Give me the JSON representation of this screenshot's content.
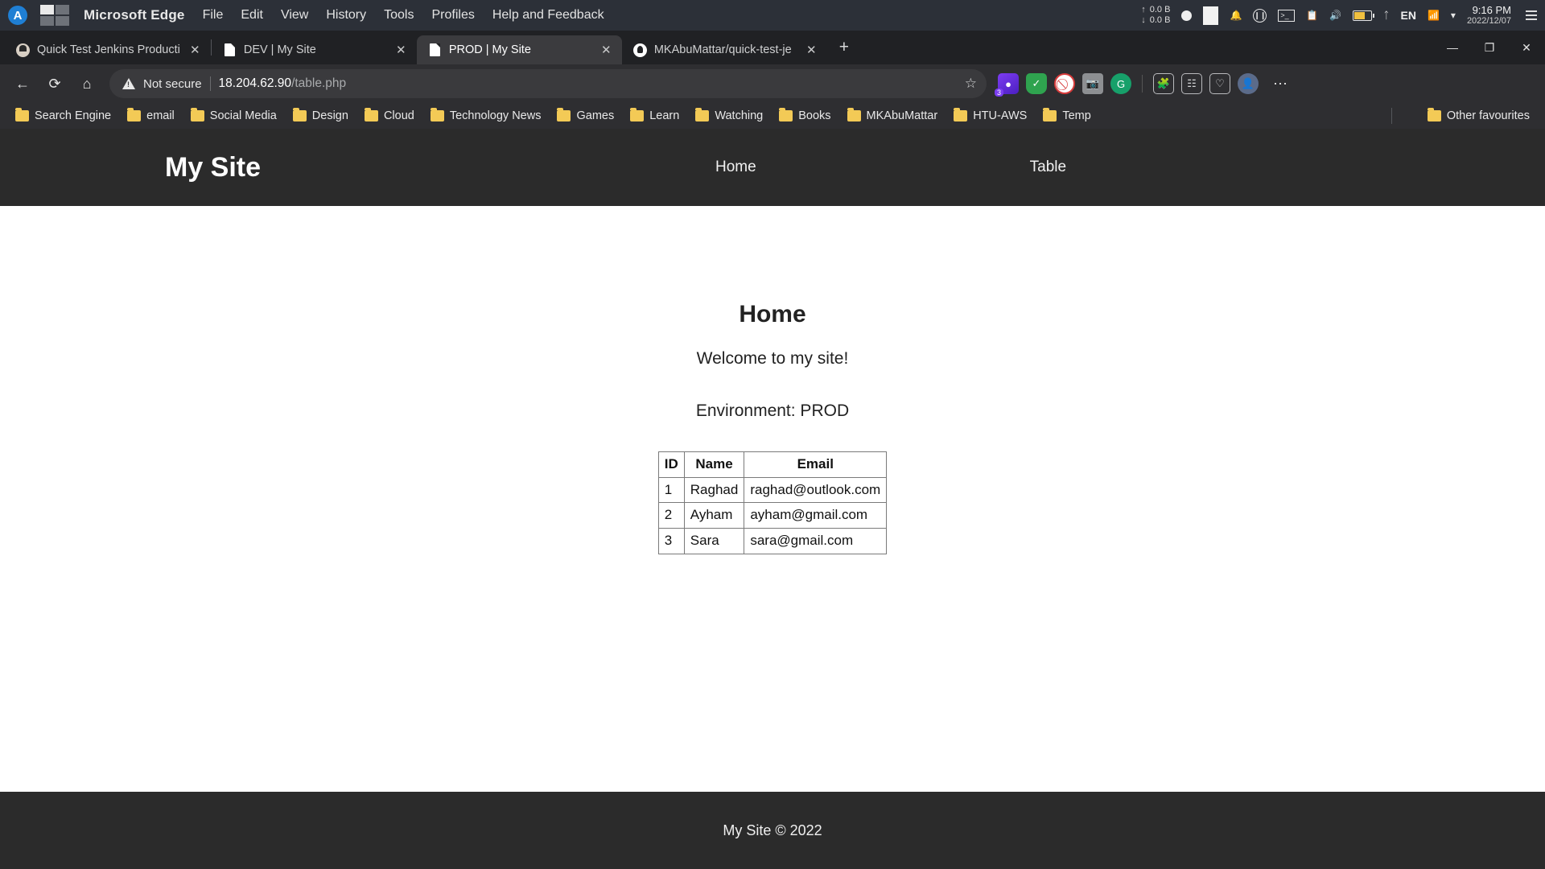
{
  "os": {
    "app_name": "Microsoft Edge",
    "menu": [
      "File",
      "Edit",
      "View",
      "History",
      "Tools",
      "Profiles",
      "Help and Feedback"
    ],
    "tray": {
      "upload": "0.0 B",
      "download": "0.0 B",
      "language": "EN",
      "time": "9:16 PM",
      "date": "2022/12/07",
      "icons": [
        "record-dot-icon",
        "screen-icon",
        "bell-icon",
        "pause-circle-icon",
        "terminal-icon",
        "clipboard-icon",
        "volume-icon",
        "battery-icon",
        "bluetooth-icon",
        "wifi-icon",
        "chevron-down-icon",
        "menu-icon"
      ]
    }
  },
  "browser": {
    "tabs": [
      {
        "title": "Quick Test Jenkins Producti",
        "favicon": "jenkins-icon",
        "active": false
      },
      {
        "title": "DEV | My Site",
        "favicon": "document-icon",
        "active": false
      },
      {
        "title": "PROD | My Site",
        "favicon": "document-icon",
        "active": true
      },
      {
        "title": "MKAbuMattar/quick-test-je",
        "favicon": "github-icon",
        "active": false
      }
    ],
    "new_tab_label": "+",
    "window_controls": {
      "minimize": "—",
      "maximize": "❐",
      "close": "✕"
    },
    "toolbar": {
      "back": "←",
      "reload": "⟳",
      "home": "⌂",
      "security_label": "Not secure",
      "url_host": "18.204.62.90",
      "url_path": "/table.php",
      "url_full": "18.204.62.90/table.php",
      "favorite": "☆",
      "extensions": [
        "purple-extension-icon",
        "green-shield-icon",
        "red-block-icon",
        "camera-icon",
        "grammarly-icon",
        "puzzle-extension-icon",
        "collections-icon",
        "browser-essentials-icon",
        "profile-avatar-icon",
        "settings-more-icon"
      ],
      "extension_badge": "3",
      "more_label": "⋯"
    },
    "bookmarks": [
      "Search Engine",
      "email",
      "Social Media",
      "Design",
      "Cloud",
      "Technology News",
      "Games",
      "Learn",
      "Watching",
      "Books",
      "MKAbuMattar",
      "HTU-AWS",
      "Temp"
    ],
    "other_favourites": "Other favourites"
  },
  "site": {
    "brand": "My Site",
    "nav": [
      {
        "label": "Home",
        "name": "nav-home"
      },
      {
        "label": "Table",
        "name": "nav-table"
      }
    ],
    "page_title": "Home",
    "welcome": "Welcome to my site!",
    "environment": "Environment: PROD",
    "footer": "My Site © 2022",
    "table": {
      "headers": [
        "ID",
        "Name",
        "Email"
      ],
      "rows": [
        {
          "id": "1",
          "name": "Raghad",
          "email": "raghad@outlook.com"
        },
        {
          "id": "2",
          "name": "Ayham",
          "email": "ayham@gmail.com"
        },
        {
          "id": "3",
          "name": "Sara",
          "email": "sara@gmail.com"
        }
      ]
    }
  },
  "colors": {
    "os_bar": "#2c3038",
    "browser_chrome": "#2e2e31",
    "tab_active": "#3b3b3e",
    "site_dark": "#2b2b2b",
    "folder_yellow": "#f3ca56"
  }
}
